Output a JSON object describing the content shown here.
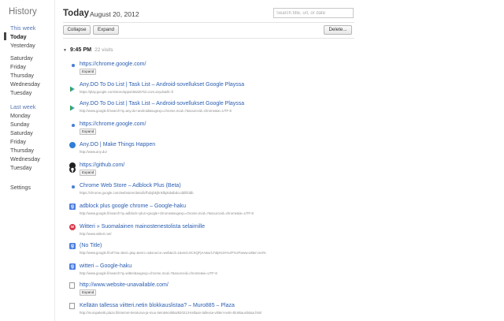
{
  "sidebar": {
    "title": "History",
    "items": [
      {
        "label": "This week",
        "kind": "section"
      },
      {
        "label": "Today",
        "kind": "selected"
      },
      {
        "label": "Yesterday",
        "kind": "day"
      },
      {
        "label": "Saturday",
        "kind": "day"
      },
      {
        "label": "Friday",
        "kind": "day"
      },
      {
        "label": "Thursday",
        "kind": "day"
      },
      {
        "label": "Wednesday",
        "kind": "day"
      },
      {
        "label": "Tuesday",
        "kind": "day"
      },
      {
        "label": "Last week",
        "kind": "section"
      },
      {
        "label": "Monday",
        "kind": "day"
      },
      {
        "label": "Sunday",
        "kind": "day"
      },
      {
        "label": "Saturday",
        "kind": "day"
      },
      {
        "label": "Friday",
        "kind": "day"
      },
      {
        "label": "Thursday",
        "kind": "day"
      },
      {
        "label": "Wednesday",
        "kind": "day"
      },
      {
        "label": "Tuesday",
        "kind": "day"
      },
      {
        "label": "Settings",
        "kind": "day"
      }
    ]
  },
  "header": {
    "title": "Today",
    "date": "August 20, 2012",
    "search_placeholder": "Search title, url, or date"
  },
  "toolbar": {
    "collapse_label": "Collapse",
    "expand_label": "Expand",
    "delete_label": "Delete..."
  },
  "group": {
    "time": "9:45 PM",
    "visits": "22 visits"
  },
  "expand_label": "Expand",
  "entries": [
    {
      "icon": "chrome-icon",
      "title": "https://chrome.google.com/",
      "url": "",
      "expand": true
    },
    {
      "icon": "play-store-icon",
      "title": "Any.DO To Do List | Task List – Android-sovellukset Google Playssa",
      "url": "https://play.google.com/store/apps/details?id=com.anydo&hl=fi",
      "expand": false
    },
    {
      "icon": "play-store-icon",
      "title": "Any.DO To Do List | Task List – Android-sovellukset Google Playssa",
      "url": "http://www.google.fi/search?q=any.do+android&sugexp=chrome,mod=7&sourceid=chrome&ie=UTF-8",
      "expand": false
    },
    {
      "icon": "chrome-icon",
      "title": "https://chrome.google.com/",
      "url": "",
      "expand": true
    },
    {
      "icon": "anydo-icon",
      "title": "Any.DO | Make Things Happen",
      "url": "http://www.any.do/",
      "expand": false
    },
    {
      "icon": "github-icon",
      "title": "https://github.com/",
      "url": "",
      "expand": true
    },
    {
      "icon": "chrome-icon",
      "title": "Chrome Web Store – Adblock Plus (Beta)",
      "url": "https://chrome.google.com/webstore/detail/cfhdojbkjhnklbpkdaibdccddilifddb",
      "expand": false
    },
    {
      "icon": "google-icon",
      "title": "adblock plus google chrome – Google-haku",
      "url": "http://www.google.fi/search?q=adblock+plus+google+chrome&sugexp=chrome,mod=7&sourceid=chrome&ie=UTF-8",
      "expand": false
    },
    {
      "icon": "witteri-icon",
      "title": "Witteri » Suomalainen mainostenestolista selaimille",
      "url": "http://www.witteri.net/",
      "expand": false
    },
    {
      "icon": "google-icon",
      "title": "(No Title)",
      "url": "http://www.google.fi/url?sa=t&rct=j&q=&esrc=s&source=web&cd=1&ved=0CSQFjAA&url=http%3A%2F%2Fwww.witteri.net%",
      "expand": false
    },
    {
      "icon": "google-icon",
      "title": "witteri – Google-haku",
      "url": "http://www.google.fi/search?q=witteri&sugexp=chrome,mod=7&sourceid=chrome&ie=UTF-8",
      "expand": false
    },
    {
      "icon": "page-icon",
      "title": "http://www.website-unavailable.com/",
      "url": "",
      "expand": true
    },
    {
      "icon": "page-icon",
      "title": "Kellään tallessa viitteri.netin blokkauslistaa? – Muro885 – Plaza",
      "url": "http://muropaketti.plaza.fi/internet-tietoturva-ja-muu-tietotekniikka/820213-kellaan-tallessa-viitteri-netin-blokkauslistaa.html",
      "expand": false
    }
  ]
}
